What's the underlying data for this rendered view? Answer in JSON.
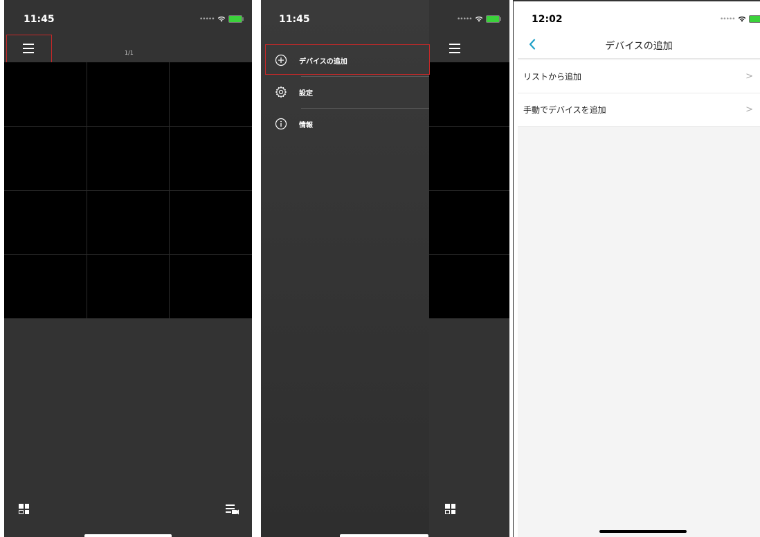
{
  "screen1": {
    "time": "11:45",
    "page_indicator": "1/1",
    "icons": {
      "menu": "hamburger-icon",
      "layout": "grid-layout-icon",
      "playback": "playback-list-icon"
    }
  },
  "screen2": {
    "time": "11:45",
    "menu_items": [
      {
        "label": "デバイスの追加",
        "icon": "add-circle-icon"
      },
      {
        "label": "設定",
        "icon": "gear-icon"
      },
      {
        "label": "情報",
        "icon": "info-icon"
      }
    ]
  },
  "screen3": {
    "time": "12:02",
    "title": "デバイスの追加",
    "items": [
      {
        "label": "リストから追加"
      },
      {
        "label": "手動でデバイスを追加"
      }
    ]
  },
  "colors": {
    "highlight": "#c62828",
    "accent": "#1fa0c8",
    "battery": "#3bd23b"
  }
}
